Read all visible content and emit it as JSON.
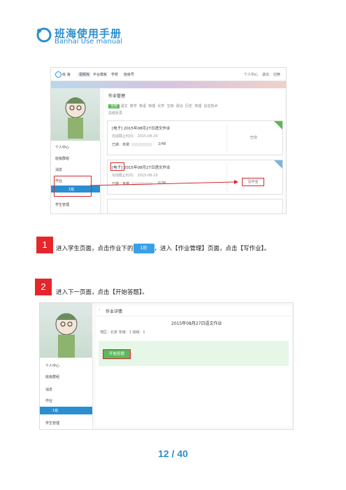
{
  "brand": {
    "title_cn": "班海使用手册",
    "title_en": "Banhai Use manual"
  },
  "shot1": {
    "nav": [
      "班 海",
      "视频库",
      "平台模板",
      "学校",
      "班级号"
    ],
    "right_nav": [
      "个人中心",
      "退出",
      "切换"
    ],
    "title": "作业管理",
    "tabs": [
      "全部",
      "语文",
      "数学",
      "英语",
      "物理",
      "化学",
      "生物",
      "政治",
      "历史",
      "地理",
      "信息技术"
    ],
    "tab2": "总结反思",
    "side_items": [
      "个人中心",
      "班级群组",
      "消息",
      "作业",
      "1班",
      "学生管理"
    ],
    "card1": {
      "title": "[电子] 2015年08月27日语文作业",
      "date": "完成截止时间： 2015-08-29",
      "progress_label": "已做：未做",
      "progress_val": "2/48",
      "state": "已交"
    },
    "card2": {
      "title": "[电子] 2015年08月27日语文作业",
      "date": "完成截止时间： 2015-08-29",
      "progress_label": "已做：未做",
      "progress_val": "0/38",
      "state": "写作业"
    }
  },
  "step1": {
    "num": "1",
    "text_a": "进入学生页面，点击作业下的",
    "btn": "1班",
    "text_b": "，进入【作业管理】页面，点击【写作业】。"
  },
  "step2": {
    "num": "2",
    "text": "进入下一页面，点击【开始答题】。"
  },
  "shot2": {
    "back": "作业详情",
    "hw_title": "2015年08月27日语文作业",
    "meta": "地区：北京  年级：1 班级：1",
    "start": "开始答题",
    "side_items": [
      "个人中心",
      "班级群组",
      "消息",
      "作业",
      "1班",
      "学生管理"
    ]
  },
  "page": "12 / 40"
}
